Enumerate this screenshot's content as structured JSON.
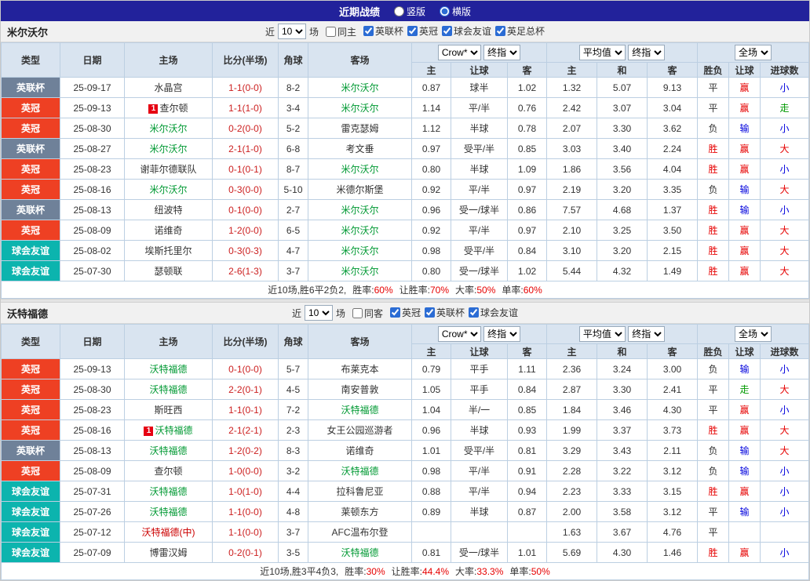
{
  "topbar": {
    "title": "近期战绩",
    "layout_options": [
      {
        "label": "竖版",
        "selected": false
      },
      {
        "label": "横版",
        "selected": true
      }
    ]
  },
  "colors": {
    "topbar_bg": "#22229b",
    "focus_team_green": "#009933",
    "win_red": "#e60000",
    "lose_blue": "#0000dd",
    "push_green": "#009900",
    "league_cup_gray": "#6f8199",
    "championship_red": "#ee4023",
    "friendly_teal": "#0cb4ae"
  },
  "sections": [
    {
      "team": "米尔沃尔",
      "filters": {
        "near_label": "近",
        "count": "10",
        "games_label": "场",
        "same_label": "同主",
        "same_checked": false,
        "comps": [
          {
            "label": "英联杯",
            "checked": true
          },
          {
            "label": "英冠",
            "checked": true
          },
          {
            "label": "球会友谊",
            "checked": true
          },
          {
            "label": "英足总杯",
            "checked": true
          }
        ]
      },
      "selects": {
        "odds_company": "Crow*",
        "odds_stage": "终指",
        "avg_source": "平均值",
        "avg_stage": "终指",
        "scope": "全场"
      },
      "headers": {
        "type": "类型",
        "date": "日期",
        "home": "主场",
        "score": "比分(半场)",
        "corner": "角球",
        "away": "客场",
        "odds_sub": [
          "主",
          "让球",
          "客"
        ],
        "avg_sub": [
          "主",
          "和",
          "客"
        ],
        "result_sub": [
          "胜负",
          "让球",
          "进球数"
        ]
      },
      "rows": [
        {
          "type": "英联杯",
          "type_cls": "t-lc",
          "date": "25-09-17",
          "home": "水晶宫",
          "home_cls": "",
          "home_badge": "",
          "score": "1-1(0-0)",
          "corner": "8-2",
          "away": "米尔沃尔",
          "away_cls": "focus",
          "away_badge": "",
          "odds": [
            "0.87",
            "球半",
            "1.02"
          ],
          "avg": [
            "1.32",
            "5.07",
            "9.13"
          ],
          "res": "平",
          "res_cls": "dark",
          "hcp": "赢",
          "hcp_cls": "red",
          "goal": "小",
          "goal_cls": "blue"
        },
        {
          "type": "英冠",
          "type_cls": "t-ch",
          "date": "25-09-13",
          "home": "查尔顿",
          "home_cls": "",
          "home_badge": "1",
          "score": "1-1(1-0)",
          "corner": "3-4",
          "away": "米尔沃尔",
          "away_cls": "focus",
          "away_badge": "",
          "odds": [
            "1.14",
            "平/半",
            "0.76"
          ],
          "avg": [
            "2.42",
            "3.07",
            "3.04"
          ],
          "res": "平",
          "res_cls": "dark",
          "hcp": "赢",
          "hcp_cls": "red",
          "goal": "走",
          "goal_cls": "green"
        },
        {
          "type": "英冠",
          "type_cls": "t-ch",
          "date": "25-08-30",
          "home": "米尔沃尔",
          "home_cls": "focus",
          "home_badge": "",
          "score": "0-2(0-0)",
          "corner": "5-2",
          "away": "雷克瑟姆",
          "away_cls": "",
          "away_badge": "",
          "odds": [
            "1.12",
            "半球",
            "0.78"
          ],
          "avg": [
            "2.07",
            "3.30",
            "3.62"
          ],
          "res": "负",
          "res_cls": "dark",
          "hcp": "输",
          "hcp_cls": "blue",
          "goal": "小",
          "goal_cls": "blue"
        },
        {
          "type": "英联杯",
          "type_cls": "t-lc",
          "date": "25-08-27",
          "home": "米尔沃尔",
          "home_cls": "focus",
          "home_badge": "",
          "score": "2-1(1-0)",
          "corner": "6-8",
          "away": "考文垂",
          "away_cls": "",
          "away_badge": "",
          "odds": [
            "0.97",
            "受平/半",
            "0.85"
          ],
          "avg": [
            "3.03",
            "3.40",
            "2.24"
          ],
          "res": "胜",
          "res_cls": "red",
          "hcp": "赢",
          "hcp_cls": "red",
          "goal": "大",
          "goal_cls": "red"
        },
        {
          "type": "英冠",
          "type_cls": "t-ch",
          "date": "25-08-23",
          "home": "谢菲尔德联队",
          "home_cls": "",
          "home_badge": "",
          "score": "0-1(0-1)",
          "corner": "8-7",
          "away": "米尔沃尔",
          "away_cls": "focus",
          "away_badge": "",
          "odds": [
            "0.80",
            "半球",
            "1.09"
          ],
          "avg": [
            "1.86",
            "3.56",
            "4.04"
          ],
          "res": "胜",
          "res_cls": "red",
          "hcp": "赢",
          "hcp_cls": "red",
          "goal": "小",
          "goal_cls": "blue"
        },
        {
          "type": "英冠",
          "type_cls": "t-ch",
          "date": "25-08-16",
          "home": "米尔沃尔",
          "home_cls": "focus",
          "home_badge": "",
          "score": "0-3(0-0)",
          "corner": "5-10",
          "away": "米德尔斯堡",
          "away_cls": "",
          "away_badge": "",
          "odds": [
            "0.92",
            "平/半",
            "0.97"
          ],
          "avg": [
            "2.19",
            "3.20",
            "3.35"
          ],
          "res": "负",
          "res_cls": "dark",
          "hcp": "输",
          "hcp_cls": "blue",
          "goal": "大",
          "goal_cls": "red"
        },
        {
          "type": "英联杯",
          "type_cls": "t-lc",
          "date": "25-08-13",
          "home": "纽波特",
          "home_cls": "",
          "home_badge": "",
          "score": "0-1(0-0)",
          "corner": "2-7",
          "away": "米尔沃尔",
          "away_cls": "focus",
          "away_badge": "",
          "odds": [
            "0.96",
            "受一/球半",
            "0.86"
          ],
          "avg": [
            "7.57",
            "4.68",
            "1.37"
          ],
          "res": "胜",
          "res_cls": "red",
          "hcp": "输",
          "hcp_cls": "blue",
          "goal": "小",
          "goal_cls": "blue"
        },
        {
          "type": "英冠",
          "type_cls": "t-ch",
          "date": "25-08-09",
          "home": "诺维奇",
          "home_cls": "",
          "home_badge": "",
          "score": "1-2(0-0)",
          "corner": "6-5",
          "away": "米尔沃尔",
          "away_cls": "focus",
          "away_badge": "",
          "odds": [
            "0.92",
            "平/半",
            "0.97"
          ],
          "avg": [
            "2.10",
            "3.25",
            "3.50"
          ],
          "res": "胜",
          "res_cls": "red",
          "hcp": "赢",
          "hcp_cls": "red",
          "goal": "大",
          "goal_cls": "red"
        },
        {
          "type": "球会友谊",
          "type_cls": "t-fr",
          "date": "25-08-02",
          "home": "埃斯托里尔",
          "home_cls": "",
          "home_badge": "",
          "score": "0-3(0-3)",
          "corner": "4-7",
          "away": "米尔沃尔",
          "away_cls": "focus",
          "away_badge": "",
          "odds": [
            "0.98",
            "受平/半",
            "0.84"
          ],
          "avg": [
            "3.10",
            "3.20",
            "2.15"
          ],
          "res": "胜",
          "res_cls": "red",
          "hcp": "赢",
          "hcp_cls": "red",
          "goal": "大",
          "goal_cls": "red"
        },
        {
          "type": "球会友谊",
          "type_cls": "t-fr",
          "date": "25-07-30",
          "home": "瑟顿联",
          "home_cls": "",
          "home_badge": "",
          "score": "2-6(1-3)",
          "corner": "3-7",
          "away": "米尔沃尔",
          "away_cls": "focus",
          "away_badge": "",
          "odds": [
            "0.80",
            "受一/球半",
            "1.02"
          ],
          "avg": [
            "5.44",
            "4.32",
            "1.49"
          ],
          "res": "胜",
          "res_cls": "red",
          "hcp": "赢",
          "hcp_cls": "red",
          "goal": "大",
          "goal_cls": "red"
        }
      ],
      "summary": {
        "prefix": "近10场,胜6平2负2,",
        "stats": [
          {
            "label": "胜率:",
            "value": "60%"
          },
          {
            "label": "让胜率:",
            "value": "70%"
          },
          {
            "label": "大率:",
            "value": "50%"
          },
          {
            "label": "单率:",
            "value": "60%"
          }
        ]
      }
    },
    {
      "team": "沃特福德",
      "filters": {
        "near_label": "近",
        "count": "10",
        "games_label": "场",
        "same_label": "同客",
        "same_checked": false,
        "comps": [
          {
            "label": "英冠",
            "checked": true
          },
          {
            "label": "英联杯",
            "checked": true
          },
          {
            "label": "球会友谊",
            "checked": true
          }
        ]
      },
      "selects": {
        "odds_company": "Crow*",
        "odds_stage": "终指",
        "avg_source": "平均值",
        "avg_stage": "终指",
        "scope": "全场"
      },
      "headers": {
        "type": "类型",
        "date": "日期",
        "home": "主场",
        "score": "比分(半场)",
        "corner": "角球",
        "away": "客场",
        "odds_sub": [
          "主",
          "让球",
          "客"
        ],
        "avg_sub": [
          "主",
          "和",
          "客"
        ],
        "result_sub": [
          "胜负",
          "让球",
          "进球数"
        ]
      },
      "rows": [
        {
          "type": "英冠",
          "type_cls": "t-ch",
          "date": "25-09-13",
          "home": "沃特福德",
          "home_cls": "focus",
          "home_badge": "",
          "score": "0-1(0-0)",
          "corner": "5-7",
          "away": "布莱克本",
          "away_cls": "",
          "away_badge": "",
          "odds": [
            "0.79",
            "平手",
            "1.11"
          ],
          "avg": [
            "2.36",
            "3.24",
            "3.00"
          ],
          "res": "负",
          "res_cls": "dark",
          "hcp": "输",
          "hcp_cls": "blue",
          "goal": "小",
          "goal_cls": "blue"
        },
        {
          "type": "英冠",
          "type_cls": "t-ch",
          "date": "25-08-30",
          "home": "沃特福德",
          "home_cls": "focus",
          "home_badge": "",
          "score": "2-2(0-1)",
          "corner": "4-5",
          "away": "南安普敦",
          "away_cls": "",
          "away_badge": "",
          "odds": [
            "1.05",
            "平手",
            "0.84"
          ],
          "avg": [
            "2.87",
            "3.30",
            "2.41"
          ],
          "res": "平",
          "res_cls": "dark",
          "hcp": "走",
          "hcp_cls": "green",
          "goal": "大",
          "goal_cls": "red"
        },
        {
          "type": "英冠",
          "type_cls": "t-ch",
          "date": "25-08-23",
          "home": "斯旺西",
          "home_cls": "",
          "home_badge": "",
          "score": "1-1(0-1)",
          "corner": "7-2",
          "away": "沃特福德",
          "away_cls": "focus",
          "away_badge": "",
          "odds": [
            "1.04",
            "半/一",
            "0.85"
          ],
          "avg": [
            "1.84",
            "3.46",
            "4.30"
          ],
          "res": "平",
          "res_cls": "dark",
          "hcp": "赢",
          "hcp_cls": "red",
          "goal": "小",
          "goal_cls": "blue"
        },
        {
          "type": "英冠",
          "type_cls": "t-ch",
          "date": "25-08-16",
          "home": "沃特福德",
          "home_cls": "focus",
          "home_badge": "1",
          "score": "2-1(2-1)",
          "corner": "2-3",
          "away": "女王公园巡游者",
          "away_cls": "",
          "away_badge": "",
          "odds": [
            "0.96",
            "半球",
            "0.93"
          ],
          "avg": [
            "1.99",
            "3.37",
            "3.73"
          ],
          "res": "胜",
          "res_cls": "red",
          "hcp": "赢",
          "hcp_cls": "red",
          "goal": "大",
          "goal_cls": "red"
        },
        {
          "type": "英联杯",
          "type_cls": "t-lc",
          "date": "25-08-13",
          "home": "沃特福德",
          "home_cls": "focus",
          "home_badge": "",
          "score": "1-2(0-2)",
          "corner": "8-3",
          "away": "诺维奇",
          "away_cls": "",
          "away_badge": "",
          "odds": [
            "1.01",
            "受平/半",
            "0.81"
          ],
          "avg": [
            "3.29",
            "3.43",
            "2.11"
          ],
          "res": "负",
          "res_cls": "dark",
          "hcp": "输",
          "hcp_cls": "blue",
          "goal": "大",
          "goal_cls": "red"
        },
        {
          "type": "英冠",
          "type_cls": "t-ch",
          "date": "25-08-09",
          "home": "查尔顿",
          "home_cls": "",
          "home_badge": "",
          "score": "1-0(0-0)",
          "corner": "3-2",
          "away": "沃特福德",
          "away_cls": "focus",
          "away_badge": "",
          "odds": [
            "0.98",
            "平/半",
            "0.91"
          ],
          "avg": [
            "2.28",
            "3.22",
            "3.12"
          ],
          "res": "负",
          "res_cls": "dark",
          "hcp": "输",
          "hcp_cls": "blue",
          "goal": "小",
          "goal_cls": "blue"
        },
        {
          "type": "球会友谊",
          "type_cls": "t-fr",
          "date": "25-07-31",
          "home": "沃特福德",
          "home_cls": "focus",
          "home_badge": "",
          "score": "1-0(1-0)",
          "corner": "4-4",
          "away": "拉科鲁尼亚",
          "away_cls": "",
          "away_badge": "",
          "odds": [
            "0.88",
            "平/半",
            "0.94"
          ],
          "avg": [
            "2.23",
            "3.33",
            "3.15"
          ],
          "res": "胜",
          "res_cls": "red",
          "hcp": "赢",
          "hcp_cls": "red",
          "goal": "小",
          "goal_cls": "blue"
        },
        {
          "type": "球会友谊",
          "type_cls": "t-fr",
          "date": "25-07-26",
          "home": "沃特福德",
          "home_cls": "focus",
          "home_badge": "",
          "score": "1-1(0-0)",
          "corner": "4-8",
          "away": "莱顿东方",
          "away_cls": "",
          "away_badge": "",
          "odds": [
            "0.89",
            "半球",
            "0.87"
          ],
          "avg": [
            "2.00",
            "3.58",
            "3.12"
          ],
          "res": "平",
          "res_cls": "dark",
          "hcp": "输",
          "hcp_cls": "blue",
          "goal": "小",
          "goal_cls": "blue"
        },
        {
          "type": "球会友谊",
          "type_cls": "t-fr",
          "date": "25-07-12",
          "home": "沃特福德(中)",
          "home_cls": "redteam",
          "home_badge": "",
          "score": "1-1(0-0)",
          "corner": "3-7",
          "away": "AFC温布尔登",
          "away_cls": "",
          "away_badge": "",
          "odds": [
            "",
            "",
            ""
          ],
          "avg": [
            "1.63",
            "3.67",
            "4.76"
          ],
          "res": "平",
          "res_cls": "dark",
          "hcp": "",
          "hcp_cls": "dark",
          "goal": "",
          "goal_cls": "dark"
        },
        {
          "type": "球会友谊",
          "type_cls": "t-fr",
          "date": "25-07-09",
          "home": "博雷汉姆",
          "home_cls": "",
          "home_badge": "",
          "score": "0-2(0-1)",
          "corner": "3-5",
          "away": "沃特福德",
          "away_cls": "focus",
          "away_badge": "",
          "odds": [
            "0.81",
            "受一/球半",
            "1.01"
          ],
          "avg": [
            "5.69",
            "4.30",
            "1.46"
          ],
          "res": "胜",
          "res_cls": "red",
          "hcp": "赢",
          "hcp_cls": "red",
          "goal": "小",
          "goal_cls": "blue"
        }
      ],
      "summary": {
        "prefix": "近10场,胜3平4负3,",
        "stats": [
          {
            "label": "胜率:",
            "value": "30%"
          },
          {
            "label": "让胜率:",
            "value": "44.4%"
          },
          {
            "label": "大率:",
            "value": "33.3%"
          },
          {
            "label": "单率:",
            "value": "50%"
          }
        ]
      }
    }
  ]
}
